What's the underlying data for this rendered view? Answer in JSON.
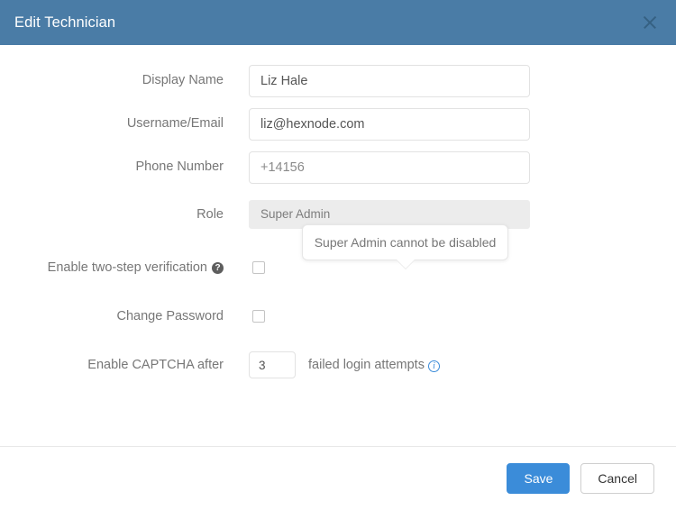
{
  "header": {
    "title": "Edit Technician",
    "close_icon": "close-icon"
  },
  "form": {
    "fields": [
      {
        "label": "Display Name",
        "value": "Liz Hale",
        "placeholder": ""
      },
      {
        "label": "Username/Email",
        "value": "liz@hexnode.com",
        "placeholder": ""
      },
      {
        "label": "Phone Number",
        "value": "+14156",
        "placeholder": ""
      }
    ],
    "role": {
      "label": "Role",
      "value": "Super Admin"
    },
    "two_step": {
      "label": "Enable two-step verification",
      "help_icon": "help-circle-icon",
      "checked": false
    },
    "change_password": {
      "label": "Change Password",
      "checked": false
    },
    "captcha": {
      "label": "Enable CAPTCHA after",
      "value": "3",
      "suffix": "failed login attempts",
      "info_icon": "info-circle-icon"
    }
  },
  "tooltip": {
    "text": "Super Admin cannot be disabled"
  },
  "footer": {
    "save_label": "Save",
    "cancel_label": "Cancel"
  },
  "colors": {
    "header_blue": "#4a7ca6",
    "primary_blue": "#3b8cd9",
    "disabled_gray": "#ececec",
    "label_gray": "#777777",
    "info_blue": "#3b8cd9"
  }
}
